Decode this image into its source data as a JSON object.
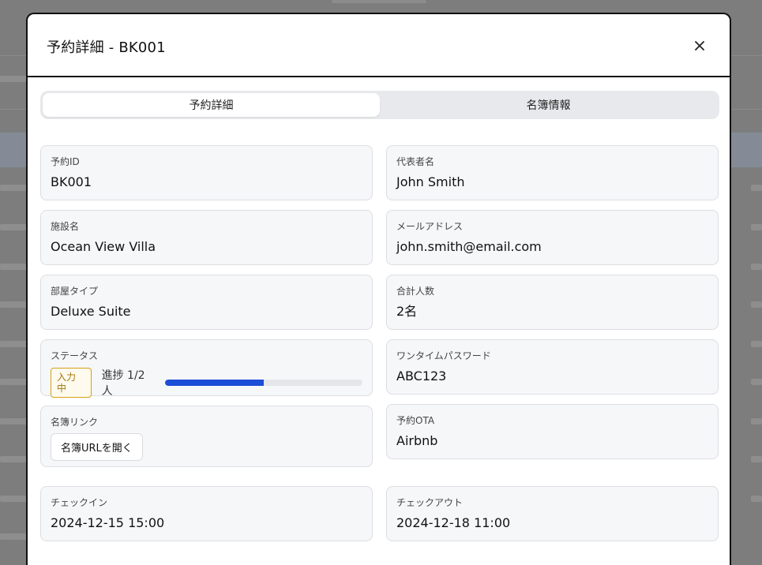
{
  "modal": {
    "title": "予約詳細 - BK001"
  },
  "tabs": [
    {
      "label": "予約詳細",
      "active": true
    },
    {
      "label": "名簿情報",
      "active": false
    }
  ],
  "fields": {
    "booking_id": {
      "label": "予約ID",
      "value": "BK001"
    },
    "representative": {
      "label": "代表者名",
      "value": "John Smith"
    },
    "facility": {
      "label": "施設名",
      "value": "Ocean View Villa"
    },
    "email": {
      "label": "メールアドレス",
      "value": "john.smith@email.com"
    },
    "room_type": {
      "label": "部屋タイプ",
      "value": "Deluxe Suite"
    },
    "total_guests": {
      "label": "合計人数",
      "value": "2名"
    },
    "status": {
      "label": "ステータス",
      "badge": "入力中",
      "progress_text": "進捗 1/2人",
      "progress_fraction": 0.5
    },
    "otp": {
      "label": "ワンタイムパスワード",
      "value": "ABC123"
    },
    "roster_link": {
      "label": "名簿リンク",
      "button": "名簿URLを開く"
    },
    "ota": {
      "label": "予約OTA",
      "value": "Airbnb"
    },
    "checkin": {
      "label": "チェックイン",
      "value": "2024-12-15 15:00"
    },
    "checkout": {
      "label": "チェックアウト",
      "value": "2024-12-18 11:00"
    }
  },
  "colors": {
    "progress": "#1d4ed8",
    "badge_border": "#d4a017"
  }
}
